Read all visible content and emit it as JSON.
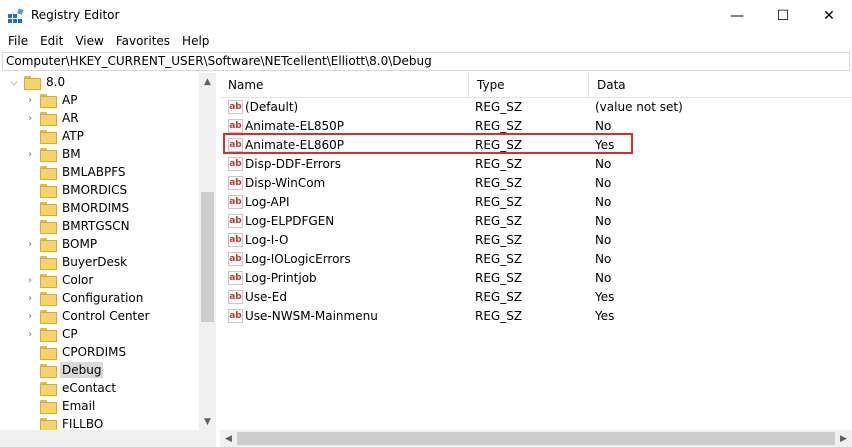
{
  "window": {
    "title": "Registry Editor",
    "minimize": "—",
    "maximize": "☐",
    "close": "✕"
  },
  "menu": [
    "File",
    "Edit",
    "View",
    "Favorites",
    "Help"
  ],
  "address": "Computer\\HKEY_CURRENT_USER\\Software\\NETcellent\\Elliott\\8.0\\Debug",
  "tree": {
    "root": "8.0",
    "items": [
      {
        "label": "AP",
        "expandable": true
      },
      {
        "label": "AR",
        "expandable": true
      },
      {
        "label": "ATP",
        "expandable": false
      },
      {
        "label": "BM",
        "expandable": true
      },
      {
        "label": "BMLABPFS",
        "expandable": false
      },
      {
        "label": "BMORDICS",
        "expandable": false
      },
      {
        "label": "BMORDIMS",
        "expandable": false
      },
      {
        "label": "BMRTGSCN",
        "expandable": false
      },
      {
        "label": "BOMP",
        "expandable": true
      },
      {
        "label": "BuyerDesk",
        "expandable": false
      },
      {
        "label": "Color",
        "expandable": true
      },
      {
        "label": "Configuration",
        "expandable": true
      },
      {
        "label": "Control Center",
        "expandable": true
      },
      {
        "label": "CP",
        "expandable": true
      },
      {
        "label": "CPORDIMS",
        "expandable": false
      },
      {
        "label": "Debug",
        "expandable": false,
        "selected": true
      },
      {
        "label": "eContact",
        "expandable": false
      },
      {
        "label": "Email",
        "expandable": false
      },
      {
        "label": "FILLBO",
        "expandable": false
      }
    ]
  },
  "columns": {
    "name": "Name",
    "type": "Type",
    "data": "Data"
  },
  "values": [
    {
      "name": "(Default)",
      "type": "REG_SZ",
      "data": "(value not set)"
    },
    {
      "name": "Animate-EL850P",
      "type": "REG_SZ",
      "data": "No"
    },
    {
      "name": "Animate-EL860P",
      "type": "REG_SZ",
      "data": "Yes",
      "highlighted": true
    },
    {
      "name": "Disp-DDF-Errors",
      "type": "REG_SZ",
      "data": "No"
    },
    {
      "name": "Disp-WinCom",
      "type": "REG_SZ",
      "data": "No"
    },
    {
      "name": "Log-API",
      "type": "REG_SZ",
      "data": "No"
    },
    {
      "name": "Log-ELPDFGEN",
      "type": "REG_SZ",
      "data": "No"
    },
    {
      "name": "Log-I-O",
      "type": "REG_SZ",
      "data": "No"
    },
    {
      "name": "Log-IOLogicErrors",
      "type": "REG_SZ",
      "data": "No"
    },
    {
      "name": "Log-Printjob",
      "type": "REG_SZ",
      "data": "No"
    },
    {
      "name": "Use-Ed",
      "type": "REG_SZ",
      "data": "Yes"
    },
    {
      "name": "Use-NWSM-Mainmenu",
      "type": "REG_SZ",
      "data": "Yes"
    }
  ],
  "reg_icon_text": "ab",
  "colors": {
    "highlight": "#e02b2b",
    "folder": "#f7d36b",
    "selected": "#d9d9d9"
  }
}
